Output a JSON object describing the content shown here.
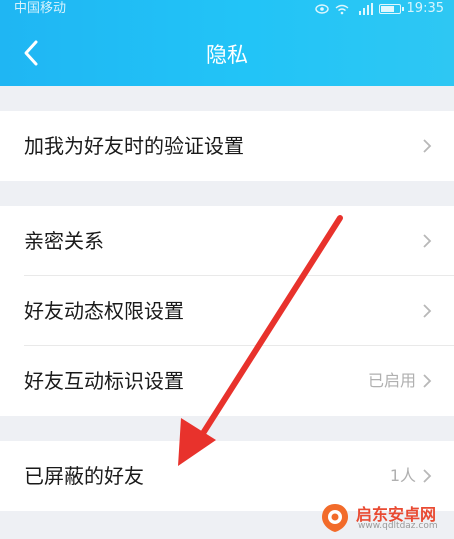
{
  "status_bar": {
    "carrier": "中国移动",
    "time": "19:35"
  },
  "header": {
    "title": "隐私"
  },
  "groups": [
    {
      "items": [
        {
          "label": "加我为好友时的验证设置",
          "value": ""
        }
      ]
    },
    {
      "items": [
        {
          "label": "亲密关系",
          "value": ""
        },
        {
          "label": "好友动态权限设置",
          "value": ""
        },
        {
          "label": "好友互动标识设置",
          "value": "已启用"
        }
      ]
    },
    {
      "items": [
        {
          "label": "已屏蔽的好友",
          "value": "1人"
        }
      ]
    }
  ],
  "watermark": {
    "name": "启东安卓网",
    "url": "www.qdltdaz.com"
  },
  "colors": {
    "header": "#22c4f7",
    "annotation_arrow": "#e8322c"
  }
}
